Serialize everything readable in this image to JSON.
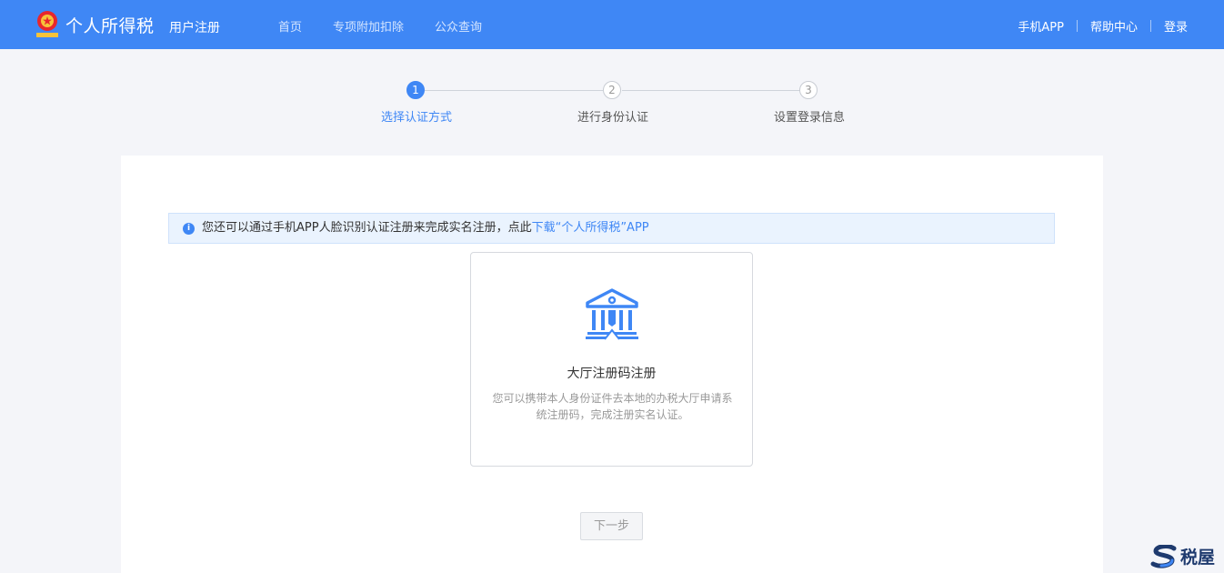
{
  "header": {
    "brand": "个人所得税",
    "subbrand": "用户注册",
    "nav": [
      "首页",
      "专项附加扣除",
      "公众查询"
    ],
    "right_nav": [
      "手机APP",
      "帮助中心",
      "登录"
    ]
  },
  "steps": [
    {
      "num": "1",
      "label": "选择认证方式",
      "active": true
    },
    {
      "num": "2",
      "label": "进行身份认证",
      "active": false
    },
    {
      "num": "3",
      "label": "设置登录信息",
      "active": false
    }
  ],
  "notice": {
    "text": "您还可以通过手机APP人脸识别认证注册来完成实名注册，点此",
    "link": "下载“个人所得税”APP"
  },
  "card": {
    "title": "大厅注册码注册",
    "desc": "您可以携带本人身份证件去本地的办税大厅申请系统注册码，完成注册实名认证。"
  },
  "next_button": "下一步",
  "watermark": "税屋",
  "colors": {
    "primary": "#3f87f5",
    "background": "#f4f5f9"
  }
}
